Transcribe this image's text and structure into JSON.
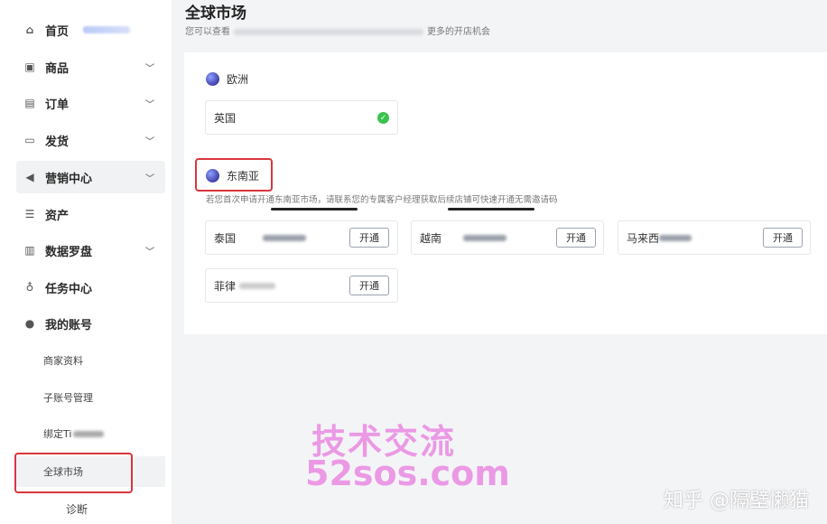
{
  "sidebar": {
    "items": [
      {
        "label": "首页",
        "icon": "home-icon"
      },
      {
        "label": "商品",
        "icon": "goods-icon"
      },
      {
        "label": "订单",
        "icon": "order-icon"
      },
      {
        "label": "发货",
        "icon": "shipping-icon"
      },
      {
        "label": "营销中心",
        "icon": "megaphone-icon"
      },
      {
        "label": "资产",
        "icon": "assets-icon"
      },
      {
        "label": "数据罗盘",
        "icon": "chart-icon"
      },
      {
        "label": "任务中心",
        "icon": "medal-icon"
      },
      {
        "label": "我的账号",
        "icon": "user-icon"
      }
    ],
    "sub_items": [
      {
        "label": "商家资料"
      },
      {
        "label": "子账号管理"
      },
      {
        "label": "绑定Ti"
      },
      {
        "label": "全球市场"
      },
      {
        "label": "诊断"
      }
    ]
  },
  "main": {
    "title": "全球市场",
    "subtitle_start": "您可以查看",
    "subtitle_end": "更多的开店机会",
    "regions": {
      "europe": {
        "name": "欧洲",
        "countries": [
          {
            "name": "英国"
          }
        ]
      },
      "sea": {
        "name": "东南亚",
        "hint": "若您首次申请开通东南亚市场，请联系您的专属客户经理获取后续店铺可快速开通无需邀请码",
        "open_label": "开通",
        "countries": [
          {
            "name": "泰国"
          },
          {
            "name": "越南"
          },
          {
            "name": "马来西"
          },
          {
            "name": "菲律"
          }
        ]
      }
    }
  },
  "watermark": {
    "line1": "技术交流",
    "line2": "52sos.com",
    "zhihu": "知乎 @隔壁懒猫"
  },
  "colors": {
    "highlight": "#d9363e",
    "watermark": "#e54fd8",
    "check": "#37c24d"
  }
}
